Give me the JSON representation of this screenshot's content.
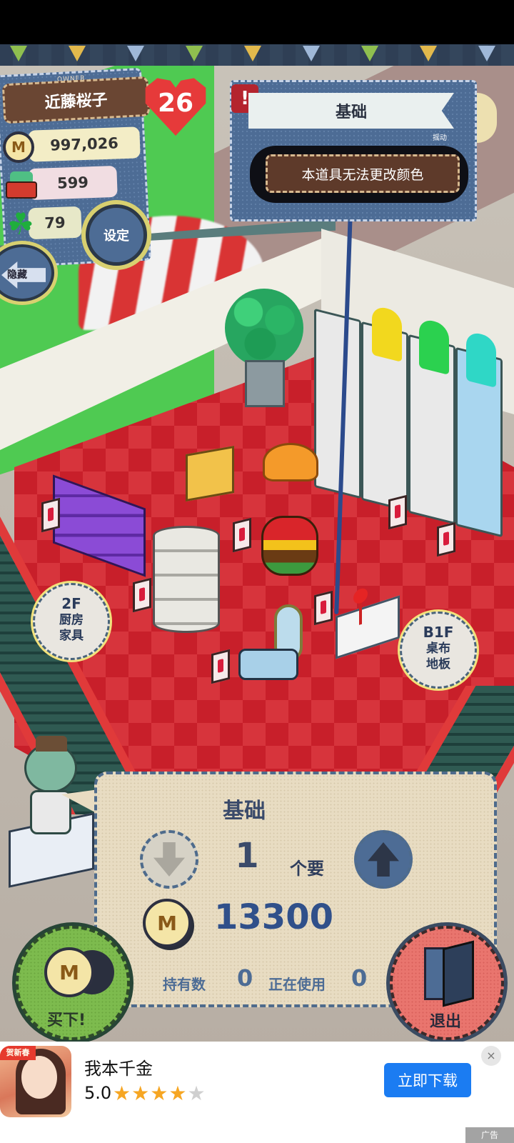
{
  "owner": {
    "tag": "OWNER",
    "name": "近藤桜子",
    "level": "26",
    "coins": "997,026",
    "bread": "599",
    "clover": "79"
  },
  "buttons": {
    "settings": "设定",
    "hide": "隐藏",
    "buy": "买下!",
    "exit": "退出"
  },
  "item_info": {
    "category": "基础",
    "sub_label": "摇动",
    "message": "本道具无法更改颜色"
  },
  "floors": {
    "up": {
      "floor": "2F",
      "line1": "厨房",
      "line2": "家具"
    },
    "down": {
      "floor": "B1F",
      "line1": "桌布",
      "line2": "地板"
    }
  },
  "purchase": {
    "title": "基础",
    "quantity": "1",
    "quantity_unit": "个要",
    "price": "13300",
    "owned_label": "持有数",
    "owned_value": "0",
    "in_use_label": "正在使用",
    "in_use_value": "0",
    "coin_symbol": "M"
  },
  "ad": {
    "badge": "贺新春",
    "title": "我本千金",
    "rating": "5.0",
    "stars": 4,
    "download_label": "立即下载",
    "close_icon": "×",
    "mark": "广告"
  },
  "colors": {
    "accent_blue": "#4d6c95",
    "floor_red": "#c81f2a",
    "download_blue": "#1b7cf2"
  }
}
